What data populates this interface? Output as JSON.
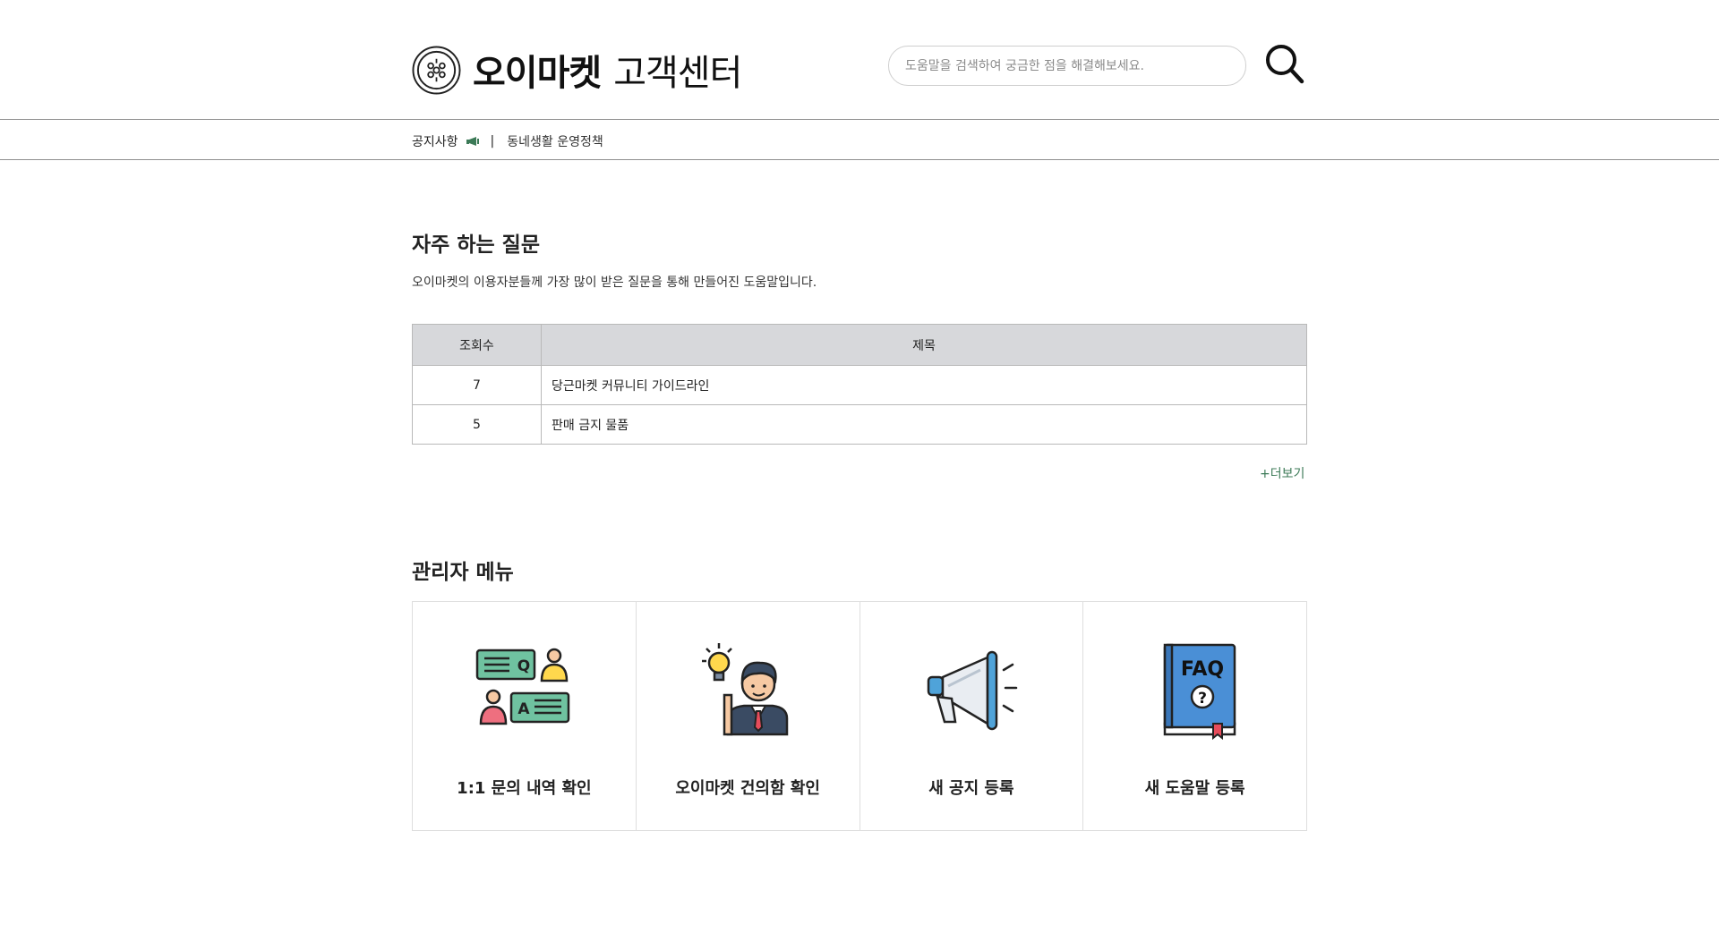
{
  "header": {
    "brand": "오이마켓",
    "subtitle": "고객센터",
    "search_placeholder": "도움말을 검색하여 궁금한 점을 해결해보세요.",
    "search_value": ""
  },
  "notice": {
    "label": "공지사항",
    "separator": "|",
    "link": "동네생활 운영정책"
  },
  "faq": {
    "title": "자주 하는 질문",
    "description": "오이마켓의 이용자분들께 가장 많이 받은 질문을 통해 만들어진 도움말입니다.",
    "columns": [
      "조회수",
      "제목"
    ],
    "rows": [
      {
        "views": "7",
        "title": "당근마켓 커뮤니티 가이드라인"
      },
      {
        "views": "5",
        "title": "판매 금지 물품"
      }
    ],
    "more": "+더보기"
  },
  "admin": {
    "title": "관리자 메뉴",
    "cards": [
      {
        "label": "1:1 문의 내역 확인",
        "icon": "qa-chat-icon"
      },
      {
        "label": "오이마켓 건의함 확인",
        "icon": "idea-person-icon"
      },
      {
        "label": "새 공지 등록",
        "icon": "megaphone-icon"
      },
      {
        "label": "새 도움말 등록",
        "icon": "faq-book-icon"
      }
    ]
  },
  "colors": {
    "accent_green": "#3c7a57",
    "table_header_bg": "#d7d8db",
    "divider": "#8f8f8f"
  }
}
